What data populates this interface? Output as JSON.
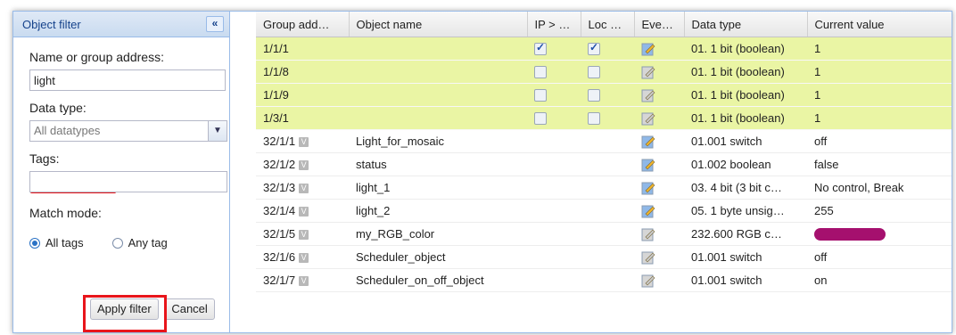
{
  "filter_panel": {
    "title": "Object filter",
    "collapse_icon": "«",
    "name_label": "Name or group address:",
    "name_value": "light",
    "datatype_label": "Data type:",
    "datatype_value": "All datatypes",
    "tags_label": "Tags:",
    "tags_value": "",
    "match_label": "Match mode:",
    "match_options": [
      "All tags",
      "Any tag"
    ],
    "match_selected": "All tags",
    "apply_label": "Apply filter",
    "cancel_label": "Cancel",
    "annotation_color": "#e8151b"
  },
  "grid": {
    "columns": [
      "Group add…",
      "Object name",
      "IP > L…",
      "Loc >…",
      "Event…",
      "Data type",
      "Current value"
    ],
    "rows": [
      {
        "address": "1/1/1",
        "tag_badge": false,
        "name": "",
        "ip": true,
        "loc": true,
        "event_active": true,
        "type": "01. 1 bit (boolean)",
        "value": "1",
        "highlight": true
      },
      {
        "address": "1/1/8",
        "tag_badge": false,
        "name": "",
        "ip": false,
        "loc": false,
        "event_active": false,
        "type": "01. 1 bit (boolean)",
        "value": "1",
        "highlight": true
      },
      {
        "address": "1/1/9",
        "tag_badge": false,
        "name": "",
        "ip": false,
        "loc": false,
        "event_active": false,
        "type": "01. 1 bit (boolean)",
        "value": "1",
        "highlight": true
      },
      {
        "address": "1/3/1",
        "tag_badge": false,
        "name": "",
        "ip": false,
        "loc": false,
        "event_active": false,
        "type": "01. 1 bit (boolean)",
        "value": "1",
        "highlight": true
      },
      {
        "address": "32/1/1",
        "tag_badge": true,
        "name": "Light_for_mosaic",
        "ip": null,
        "loc": null,
        "event_active": true,
        "type": "01.001 switch",
        "value": "off",
        "highlight": false
      },
      {
        "address": "32/1/2",
        "tag_badge": true,
        "name": "status",
        "ip": null,
        "loc": null,
        "event_active": true,
        "type": "01.002 boolean",
        "value": "false",
        "highlight": false
      },
      {
        "address": "32/1/3",
        "tag_badge": true,
        "name": "light_1",
        "ip": null,
        "loc": null,
        "event_active": true,
        "type": "03. 4 bit (3 bit c…",
        "value": "No control, Break",
        "highlight": false
      },
      {
        "address": "32/1/4",
        "tag_badge": true,
        "name": "light_2",
        "ip": null,
        "loc": null,
        "event_active": true,
        "type": "05. 1 byte unsig…",
        "value": "255",
        "highlight": false
      },
      {
        "address": "32/1/5",
        "tag_badge": true,
        "name": "my_RGB_color",
        "ip": null,
        "loc": null,
        "event_active": false,
        "type": "232.600 RGB c…",
        "value": "",
        "value_color": "#a5106e",
        "highlight": false
      },
      {
        "address": "32/1/6",
        "tag_badge": true,
        "name": "Scheduler_object",
        "ip": null,
        "loc": null,
        "event_active": false,
        "type": "01.001 switch",
        "value": "off",
        "highlight": false
      },
      {
        "address": "32/1/7",
        "tag_badge": true,
        "name": "Scheduler_on_off_object",
        "ip": null,
        "loc": null,
        "event_active": false,
        "type": "01.001 switch",
        "value": "on",
        "highlight": false
      }
    ]
  }
}
